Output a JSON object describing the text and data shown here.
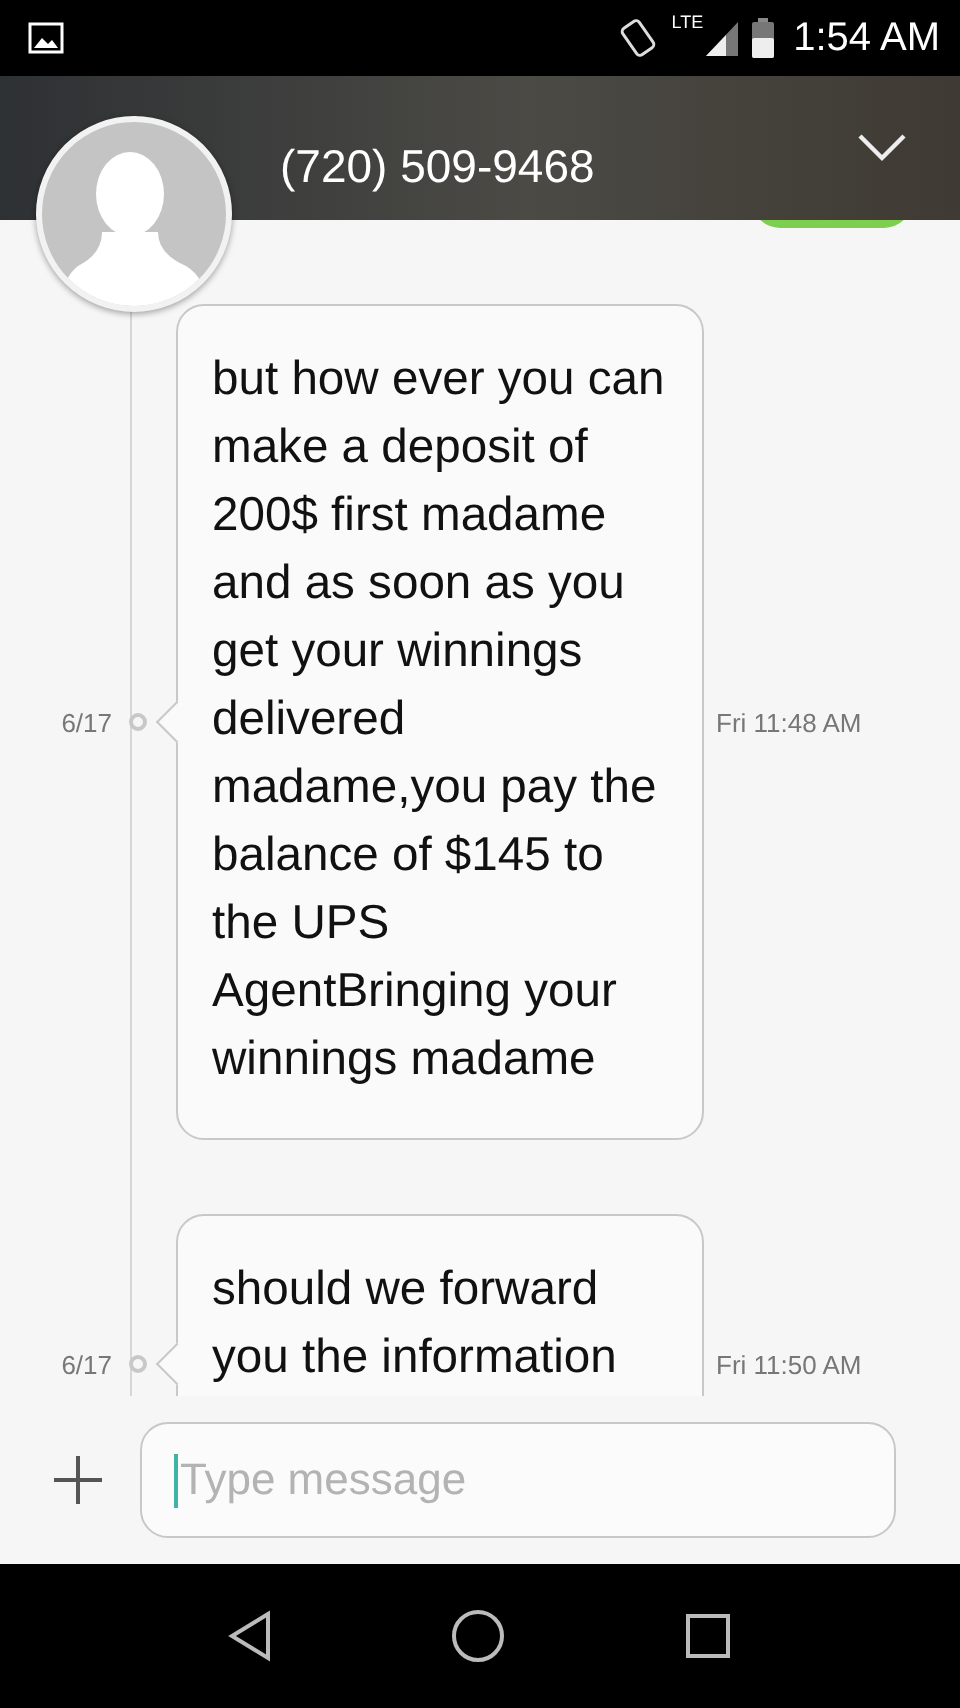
{
  "status_bar": {
    "network": "LTE",
    "time": "1:54 AM"
  },
  "header": {
    "contact": "(720) 509-9468"
  },
  "messages": [
    {
      "date": "6/17",
      "text": "but how ever you can make a deposit of 200$ first madame and as soon as you get your winnings delivered madame,you pay the balance of $145 to the UPS AgentBringing your winnings madame",
      "time": "Fri 11:48 AM"
    },
    {
      "date": "6/17",
      "text": "should we forward you the information",
      "time": "Fri 11:50 AM"
    }
  ],
  "composer": {
    "placeholder": "Type message"
  }
}
